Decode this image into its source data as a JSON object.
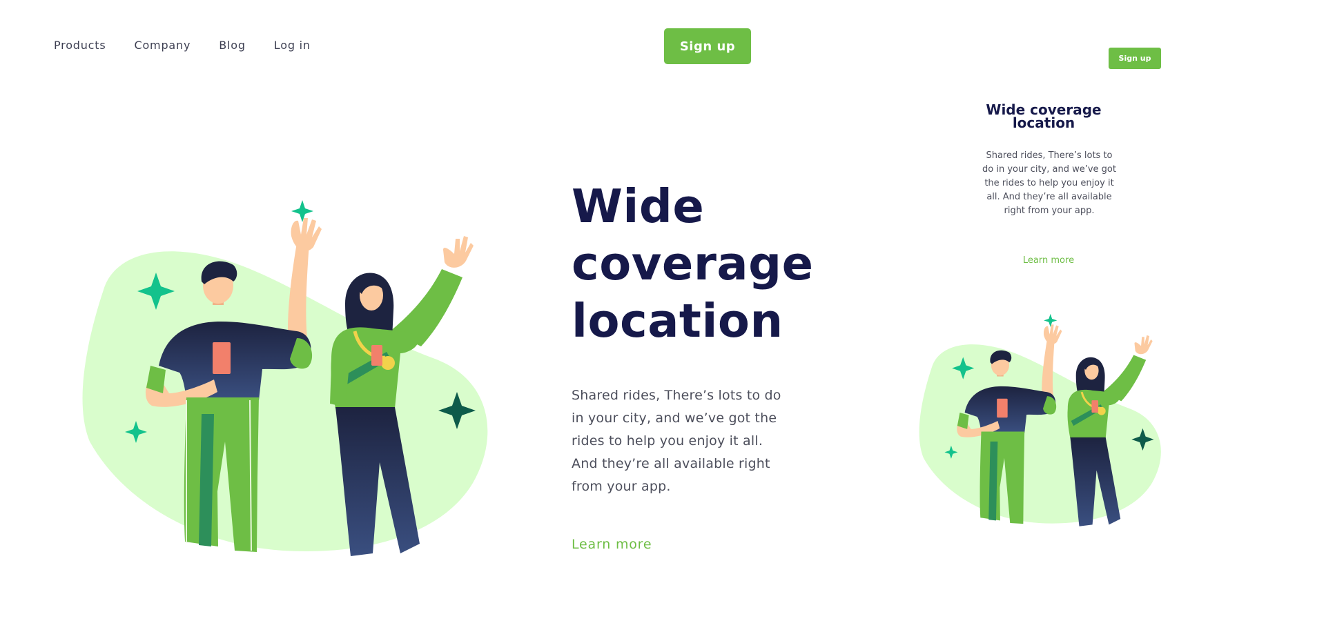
{
  "nav": {
    "items": [
      {
        "label": "Products"
      },
      {
        "label": "Company"
      },
      {
        "label": "Blog"
      },
      {
        "label": "Log in"
      }
    ]
  },
  "header": {
    "signup_label": "Sign up"
  },
  "hero": {
    "title": "Wide coverage location",
    "body": "Shared rides, There’s lots to do in your city, and we’ve got the rides to help you enjoy it all. And they’re all available right from your app.",
    "link_label": "Learn more"
  },
  "mobile_preview": {
    "signup_label": "Sign up",
    "title": "Wide coverage location",
    "body": "Shared rides, There’s lots to do in your city, and we’ve got the rides to help you enjoy it all. And they’re all available right from your app.",
    "link_label": "Learn more"
  },
  "colors": {
    "accent": "#6ebe45",
    "heading": "#16194a",
    "body_text": "#4d4f5c",
    "blob": "#d9fdcc",
    "sparkle_teal": "#13c28c",
    "sparkle_dark": "#0e5b4a",
    "shirt_navy": "#25304f"
  },
  "illustration": {
    "icons": [
      "sparkle-icon",
      "man-figure",
      "woman-figure"
    ]
  }
}
